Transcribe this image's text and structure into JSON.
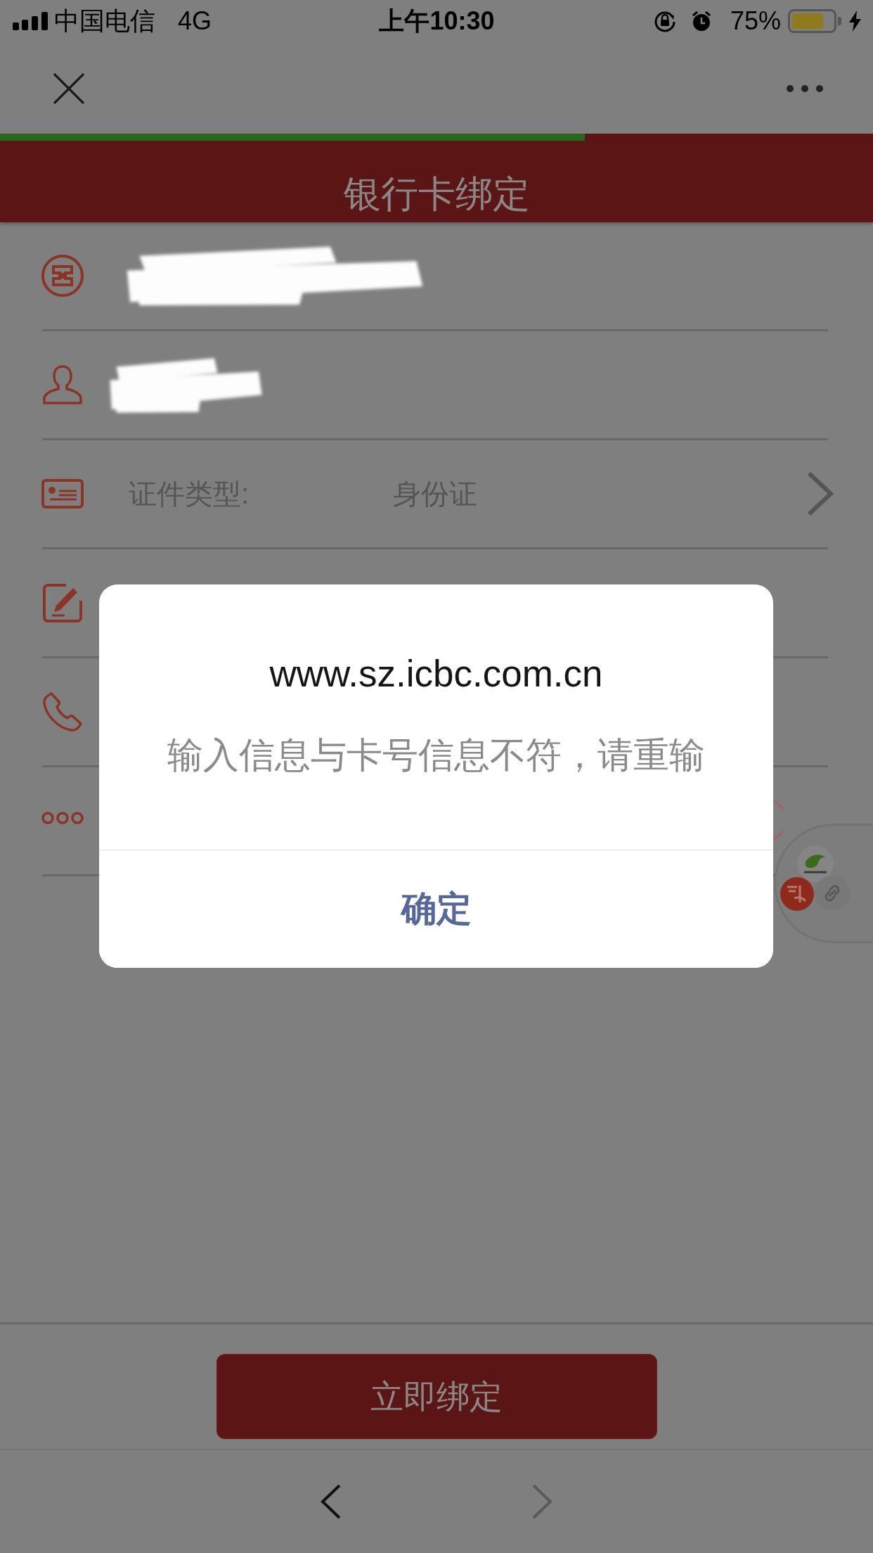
{
  "status_bar": {
    "carrier": "中国电信",
    "network": "4G",
    "time": "上午10:30",
    "battery": "75%"
  },
  "progress": {
    "level": 0.67
  },
  "header": {
    "title": "银行卡绑定"
  },
  "form_rows": [
    {
      "kind": "redacted"
    },
    {
      "kind": "redacted"
    },
    {
      "kind": "select",
      "label": "证件类型:",
      "value": "身份证"
    },
    {
      "kind": "covered"
    },
    {
      "kind": "covered"
    },
    {
      "kind": "covered"
    }
  ],
  "bind_button": {
    "label": "立即绑定"
  },
  "browser_toolbar": [
    {
      "kind": "back",
      "disabled": false
    },
    {
      "kind": "forward",
      "disabled": true
    }
  ],
  "alert": {
    "title": "www.sz.icbc.com.cn",
    "message": "输入信息与卡号信息不符，请重输",
    "button": "确定"
  }
}
